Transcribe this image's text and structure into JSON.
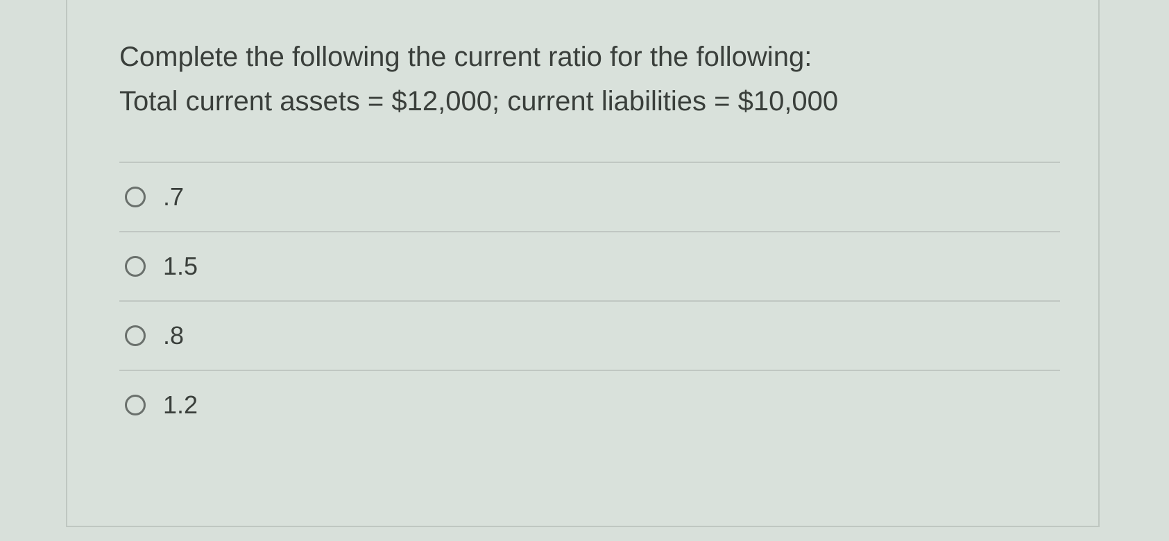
{
  "question": {
    "line1": "Complete the following the current ratio for the following:",
    "line2": "Total current assets = $12,000; current liabilities = $10,000"
  },
  "options": [
    {
      "label": ".7"
    },
    {
      "label": "1.5"
    },
    {
      "label": ".8"
    },
    {
      "label": "1.2"
    }
  ]
}
